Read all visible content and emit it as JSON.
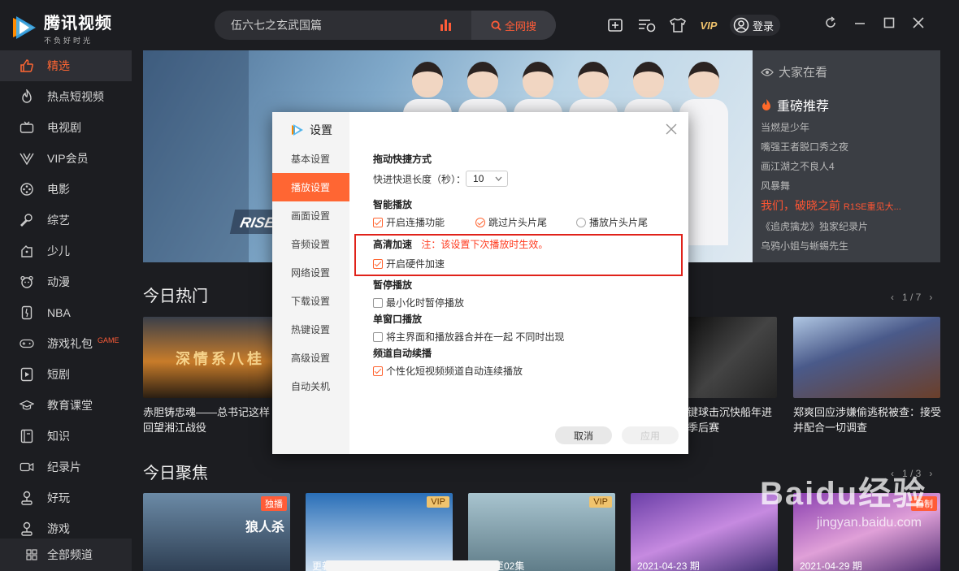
{
  "app": {
    "title": "腾讯视频",
    "slogan": "不负好时光",
    "accent": "#ff6633"
  },
  "search": {
    "value": "伍六七之玄武国篇",
    "button_label": "全网搜"
  },
  "header": {
    "vip_label": "VIP",
    "login_label": "登录",
    "icons": [
      "add-video-icon",
      "playlist-clock-icon",
      "tshirt-icon",
      "vip-icon",
      "user-icon"
    ],
    "window_controls": [
      "refresh-icon",
      "minimize-icon",
      "maximize-icon",
      "close-icon"
    ]
  },
  "sidebar": {
    "items": [
      {
        "label": "精选",
        "icon": "thumb-up-icon",
        "active": true
      },
      {
        "label": "热点短视频",
        "icon": "flame-icon"
      },
      {
        "label": "电视剧",
        "icon": "tv-icon"
      },
      {
        "label": "VIP会员",
        "icon": "vip-v-icon"
      },
      {
        "label": "电影",
        "icon": "film-reel-icon"
      },
      {
        "label": "综艺",
        "icon": "microphone-icon"
      },
      {
        "label": "少儿",
        "icon": "kid-icon"
      },
      {
        "label": "动漫",
        "icon": "bear-icon"
      },
      {
        "label": "NBA",
        "icon": "nba-icon"
      },
      {
        "label": "游戏礼包",
        "icon": "gamepad-icon",
        "badge": "GAME"
      },
      {
        "label": "短剧",
        "icon": "play-square-icon"
      },
      {
        "label": "教育课堂",
        "icon": "graduation-cap-icon"
      },
      {
        "label": "知识",
        "icon": "book-icon"
      },
      {
        "label": "纪录片",
        "icon": "camera-icon"
      },
      {
        "label": "好玩",
        "icon": "joystick-icon"
      },
      {
        "label": "游戏",
        "icon": "joystick-icon"
      }
    ],
    "all_channels_label": "全部频道"
  },
  "banner": {
    "logo_text": "RISE重"
  },
  "hotlist": {
    "header": "大家在看",
    "sub_header": "重磅推荐",
    "items": [
      {
        "text": "当燃是少年"
      },
      {
        "text": "嘴强王者脱口秀之夜"
      },
      {
        "text": "画江湖之不良人4"
      },
      {
        "text": "风暴舞"
      },
      {
        "text": "我们，破晓之前",
        "suffix": "R1SE重见大...",
        "hot": true
      },
      {
        "text": "《追虎擒龙》独家纪录片"
      },
      {
        "text": "乌鸦小姐与蜥蜴先生"
      }
    ]
  },
  "sections": {
    "hot": {
      "title": "今日热门",
      "pager": "1 / 7"
    },
    "focus": {
      "title": "今日聚焦",
      "pager": "1 / 3"
    }
  },
  "hot_cards": [
    {
      "caption": "赤胆铸忠魂——总书记这样回望湘江战役",
      "image_text": "深情系八桂"
    },
    {
      "caption": "键球击沉快船年进季后赛"
    },
    {
      "caption": "郑爽回应涉嫌偷逃税被查：接受并配合一切调查"
    }
  ],
  "focus_cards": [
    {
      "tag": "独播",
      "episode": "",
      "image_text": "狼人杀"
    },
    {
      "tag": "VIP",
      "episode": "更新至"
    },
    {
      "tag": "VIP",
      "episode": "更新至02集"
    },
    {
      "tag": "",
      "episode": "2021-04-23 期"
    },
    {
      "tag": "自制",
      "episode": "2021-04-29 期"
    }
  ],
  "settings_dialog": {
    "title": "设置",
    "nav": [
      {
        "label": "基本设置"
      },
      {
        "label": "播放设置",
        "active": true
      },
      {
        "label": "画面设置"
      },
      {
        "label": "音频设置"
      },
      {
        "label": "网络设置"
      },
      {
        "label": "下载设置"
      },
      {
        "label": "热键设置"
      },
      {
        "label": "高级设置"
      },
      {
        "label": "自动关机"
      }
    ],
    "drag_shortcut": {
      "heading": "拖动快捷方式",
      "seek_label": "快进快退长度（秒）：",
      "seek_value": "10"
    },
    "smart_play": {
      "heading": "智能播放",
      "continuous": {
        "label": "开启连播功能",
        "checked": true
      },
      "skip": {
        "label": "跳过片头片尾",
        "checked": true
      },
      "play": {
        "label": "播放片头片尾",
        "checked": false
      }
    },
    "hd": {
      "heading": "高清加速",
      "note": "注：该设置下次播放时生效。",
      "hw_accel": {
        "label": "开启硬件加速",
        "checked": true
      }
    },
    "pause": {
      "heading": "暂停播放",
      "minimize_pause": {
        "label": "最小化时暂停播放",
        "checked": false
      }
    },
    "single_window": {
      "heading": "单窗口播放",
      "merge": {
        "label": "将主界面和播放器合并在一起 不同时出现",
        "checked": false
      }
    },
    "auto_continue": {
      "heading": "频道自动续播",
      "personal": {
        "label": "个性化短视频频道自动连续播放",
        "checked": true
      }
    },
    "cancel_label": "取消",
    "apply_label": "应用"
  },
  "watermark": {
    "brand": "Baidu经验",
    "url": "jingyan.baidu.com"
  }
}
